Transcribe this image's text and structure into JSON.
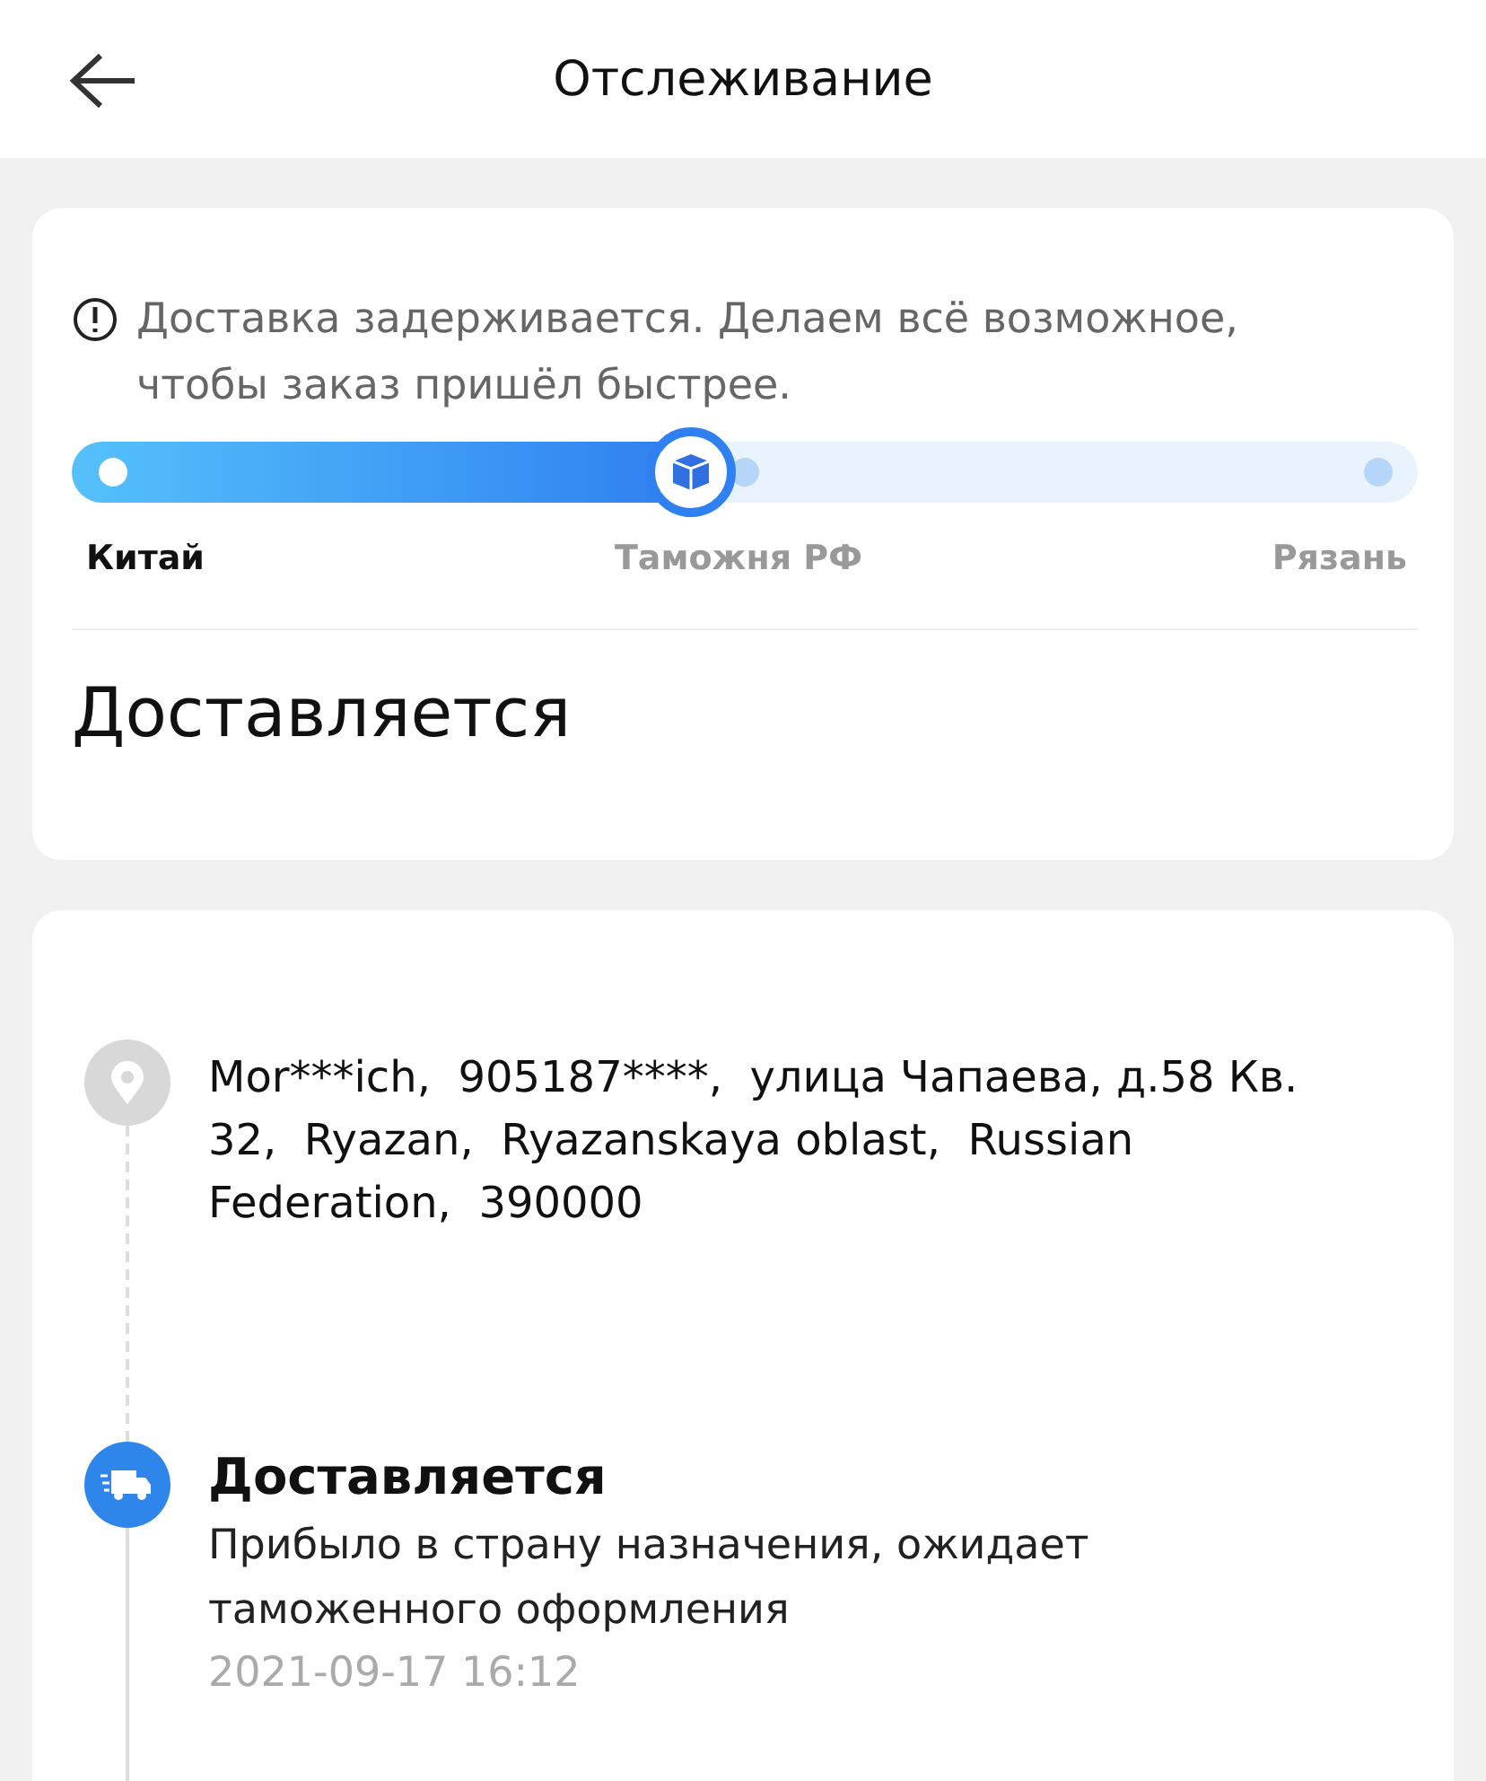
{
  "header": {
    "title": "Отслеживание"
  },
  "status_card": {
    "notice": "Доставка задерживается. Делаем всё возможное, чтобы заказ пришёл быстрее.",
    "progress": {
      "level": 0.46
    },
    "stops": [
      {
        "label": "Китай",
        "reached": true
      },
      {
        "label": "Таможня РФ",
        "reached": false
      },
      {
        "label": "Рязань",
        "reached": false
      }
    ],
    "status": "Доставляется"
  },
  "timeline": [
    {
      "kind": "address",
      "text": "Mor***ich,  905187****,  улица Чапаева, д.58 Кв. 32,  Ryazan,  Ryazanskaya oblast,  Russian Federation,  390000"
    },
    {
      "kind": "event",
      "title": "Доставляется",
      "text": "Прибыло в страну назначения, ожидает таможенного оформления",
      "time": "2021-09-17 16:12"
    }
  ]
}
